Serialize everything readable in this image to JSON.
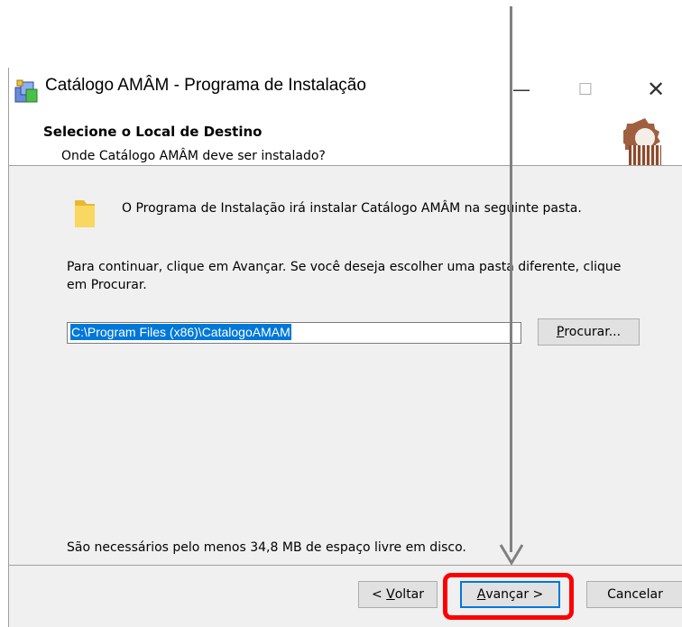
{
  "window": {
    "title": "Catálogo AMÂM - Programa de Instalação",
    "controls": {
      "minimize": "—",
      "maximize": "☐",
      "close": "✕"
    }
  },
  "header": {
    "title": "Selecione o Local de Destino",
    "subtitle": "Onde Catálogo AMÂM deve ser instalado?"
  },
  "content": {
    "intro": "O Programa de Instalação irá instalar Catálogo AMÂM na seguinte pasta.",
    "instructions": "Para continuar, clique em Avançar. Se você deseja escolher uma pasta diferente, clique em Procurar.",
    "destination_path": "C:\\Program Files (x86)\\CatalogoAMAM",
    "browse_button": {
      "accel": "P",
      "rest": "rocurar..."
    },
    "disk_space": "São necessários pelo menos 34,8 MB de espaço livre em disco."
  },
  "footer": {
    "back_button": {
      "prefix": "< ",
      "accel": "V",
      "rest": "oltar"
    },
    "next_button": {
      "accel": "A",
      "rest": "vançar >"
    },
    "cancel_button": "Cancelar"
  },
  "annotation": {
    "highlight_color": "#ff0000",
    "arrow_color": "#808080"
  }
}
